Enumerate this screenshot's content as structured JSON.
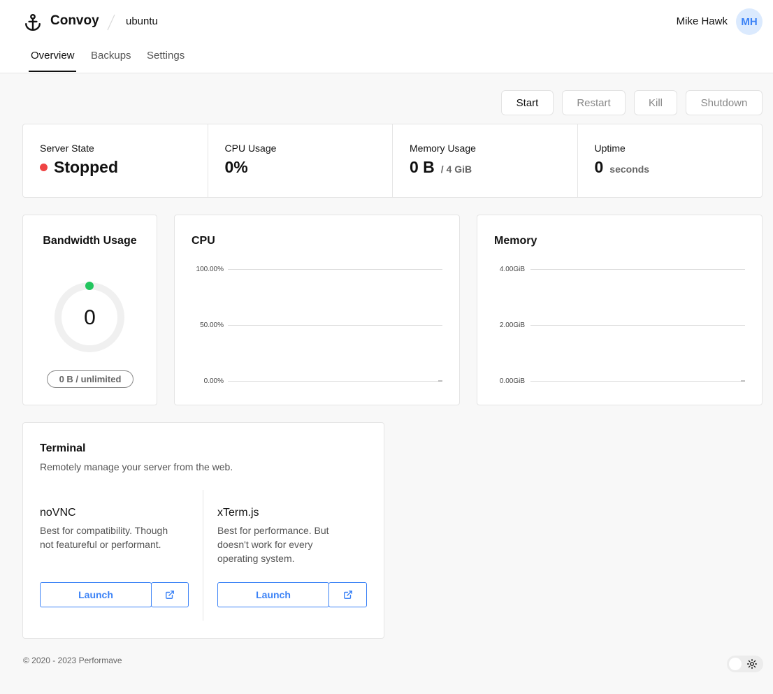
{
  "header": {
    "brand": "Convoy",
    "server_name": "ubuntu",
    "user_name": "Mike Hawk",
    "avatar_initials": "MH",
    "tabs": [
      {
        "label": "Overview",
        "active": true
      },
      {
        "label": "Backups",
        "active": false
      },
      {
        "label": "Settings",
        "active": false
      }
    ]
  },
  "power_actions": {
    "start": "Start",
    "restart": "Restart",
    "kill": "Kill",
    "shutdown": "Shutdown"
  },
  "stats": {
    "server_state": {
      "label": "Server State",
      "value": "Stopped",
      "status_color": "#ef4444"
    },
    "cpu_usage": {
      "label": "CPU Usage",
      "value": "0%"
    },
    "memory_usage": {
      "label": "Memory Usage",
      "value": "0 B",
      "limit": "/ 4 GiB"
    },
    "uptime": {
      "label": "Uptime",
      "value": "0",
      "unit": "seconds"
    }
  },
  "bandwidth": {
    "title": "Bandwidth Usage",
    "value": "0",
    "usage_text": "0 B / unlimited",
    "indicator_color": "#22c55e"
  },
  "chart_data": [
    {
      "type": "line",
      "title": "CPU",
      "y_ticks": [
        "100.00%",
        "50.00%",
        "0.00%"
      ],
      "ylim": [
        0,
        100
      ],
      "series": [
        {
          "values": [
            0,
            0
          ]
        }
      ],
      "grid": true
    },
    {
      "type": "line",
      "title": "Memory",
      "y_ticks": [
        "4.00GiB",
        "2.00GiB",
        "0.00GiB"
      ],
      "ylim": [
        0,
        4
      ],
      "series": [
        {
          "values": [
            0,
            0
          ]
        }
      ],
      "grid": true
    }
  ],
  "terminal": {
    "title": "Terminal",
    "description": "Remotely manage your server from the web.",
    "options": [
      {
        "name": "noVNC",
        "desc_lines": [
          "Best for compatibility. Though",
          "not featureful or performant."
        ],
        "launch_label": "Launch"
      },
      {
        "name": "xTerm.js",
        "desc_lines": [
          "Best for performance. But",
          "doesn't work for every",
          "operating system."
        ],
        "launch_label": "Launch"
      }
    ]
  },
  "footer": {
    "copyright": "© 2020 - 2023 Performave"
  },
  "colors": {
    "accent": "#3b82f6",
    "stopped": "#ef4444",
    "online": "#22c55e"
  },
  "icons": [
    "anchor-icon",
    "external-link-icon",
    "sun-icon"
  ]
}
